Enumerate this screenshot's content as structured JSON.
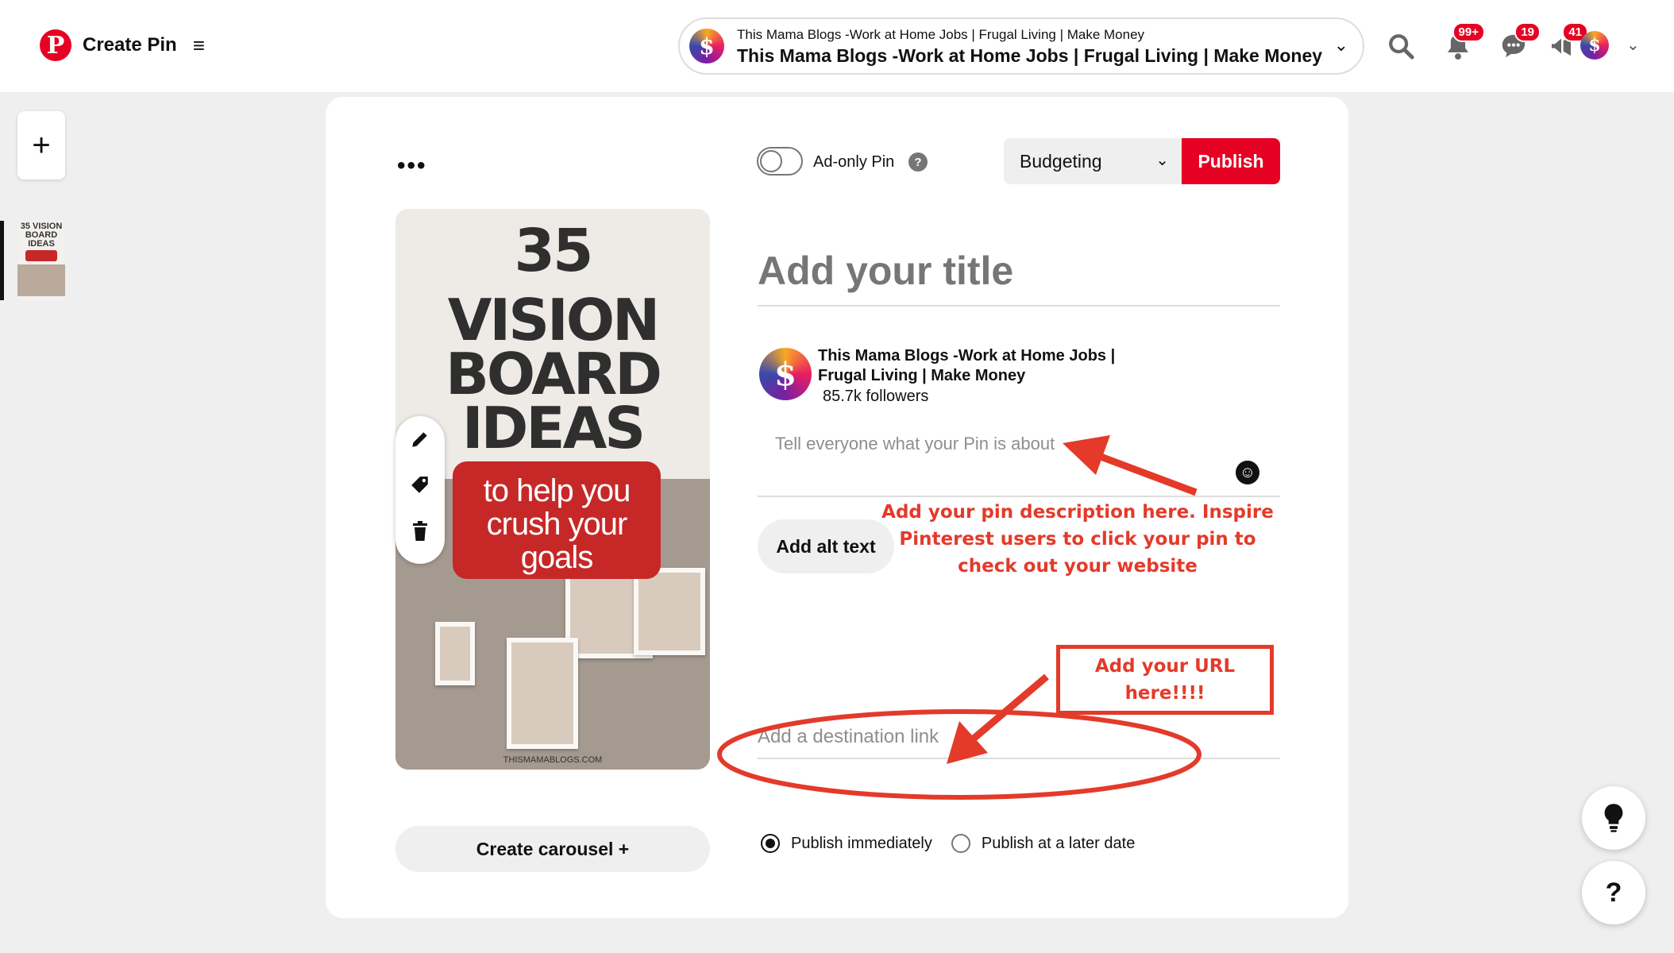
{
  "header": {
    "brand_title": "Create Pin",
    "account": {
      "small_name": "This Mama Blogs -Work at Home Jobs | Frugal Living | Make Money",
      "name": "This Mama Blogs -Work at Home Jobs | Frugal Living | Make Money",
      "avatar_glyph": "$"
    },
    "badges": {
      "notifications": "99+",
      "messages": "19",
      "updates": "41"
    }
  },
  "sidebar": {
    "add_glyph": "+",
    "thumb_text": "35 VISION BOARD IDEAS"
  },
  "editor": {
    "more_glyph": "•••",
    "ad_only_label": "Ad-only Pin",
    "help_glyph": "?",
    "board": "Budgeting",
    "publish_label": "Publish",
    "pin_image": {
      "line1": "35",
      "line2": "VISION",
      "line3": "BOARD",
      "line4": "IDEAS",
      "bubble": "to help you crush your goals",
      "site": "THISMAMABLOGS.COM"
    },
    "title_placeholder": "Add your title",
    "author": {
      "name": "This Mama Blogs -Work at Home Jobs | Frugal Living | Make Money",
      "followers": "85.7k followers"
    },
    "description_placeholder": "Tell everyone what your Pin is about",
    "alt_text_label": "Add alt text",
    "destination_placeholder": "Add a destination link",
    "carousel_label": "Create carousel +",
    "publish_options": [
      "Publish immediately",
      "Publish at a later date"
    ],
    "selected_publish_option": "Publish immediately"
  },
  "annotations": {
    "description_note": "Add your pin description here.  Inspire Pinterest users to click your pin to check out your website",
    "url_note": "Add your URL here!!!!",
    "color": "#e43a2a"
  },
  "floating": {
    "tips_icon": "lightbulb-icon",
    "help_glyph": "?"
  },
  "colors": {
    "brand_red": "#e60023",
    "annotation_red": "#e43a2a"
  }
}
